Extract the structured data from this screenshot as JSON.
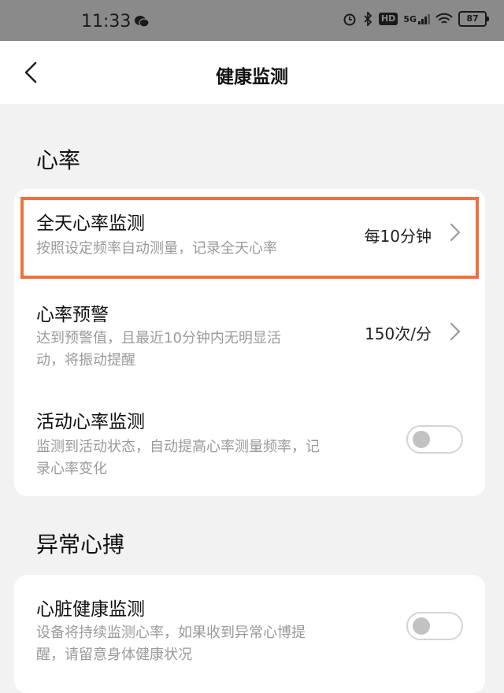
{
  "status_bar": {
    "time": "11:33",
    "network": "5G",
    "hd": "HD",
    "battery": "87",
    "icons": [
      "wechat-icon",
      "alarm-icon",
      "bluetooth-icon",
      "signal-icon",
      "wifi-icon",
      "battery-icon"
    ]
  },
  "header": {
    "title": "健康监测",
    "back_icon": "chevron-left-icon"
  },
  "sections": [
    {
      "title": "心率",
      "items": [
        {
          "title": "全天心率监测",
          "desc": "按照设定频率自动测量，记录全天心率",
          "value": "每10分钟",
          "control": "chevron"
        },
        {
          "title": "心率预警",
          "desc_lines": [
            "达到预警值，且最近10分钟内无明显活",
            "动，将振动提醒"
          ],
          "value": "150次/分",
          "control": "chevron"
        },
        {
          "title": "活动心率监测",
          "desc_lines": [
            "监测到活动状态，自动提高心率测量频率，记",
            "录心率变化"
          ],
          "control": "toggle",
          "enabled": false
        }
      ]
    },
    {
      "title": "异常心搏",
      "items": [
        {
          "title": "心脏健康监测",
          "desc_lines": [
            "设备将持续监测心率，如果收到异常心博提",
            "醒，请留意身体健康状况"
          ],
          "control": "toggle",
          "enabled": false
        }
      ]
    }
  ],
  "colors": {
    "status_bar_bg": "#8a8a8a",
    "page_bg": "#f2f2f2",
    "card_bg": "#ffffff",
    "highlight": "#f07040",
    "secondary_text": "#9a9a9a",
    "toggle_off": "#c2c2c2"
  }
}
